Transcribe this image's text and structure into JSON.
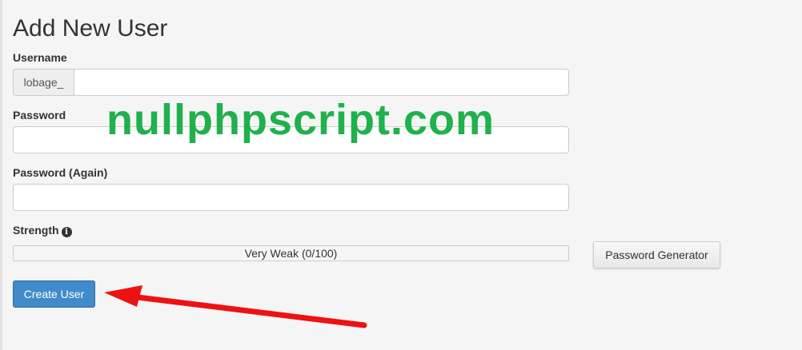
{
  "page": {
    "title": "Add New User"
  },
  "form": {
    "username": {
      "label": "Username",
      "prefix": "lobage_",
      "value": ""
    },
    "password": {
      "label": "Password",
      "value": ""
    },
    "password_again": {
      "label": "Password (Again)",
      "value": ""
    },
    "strength": {
      "label": "Strength",
      "text": "Very Weak (0/100)",
      "score": 0,
      "max": 100,
      "info_icon": "info-circle-icon"
    },
    "password_generator_label": "Password Generator",
    "create_user_label": "Create User"
  },
  "overlay": {
    "watermark": "nullphpscript.com",
    "watermark_color": "#1fb14b",
    "arrow_color": "#ee1111"
  },
  "colors": {
    "primary_button": "#428bca",
    "background": "#f5f5f5"
  }
}
